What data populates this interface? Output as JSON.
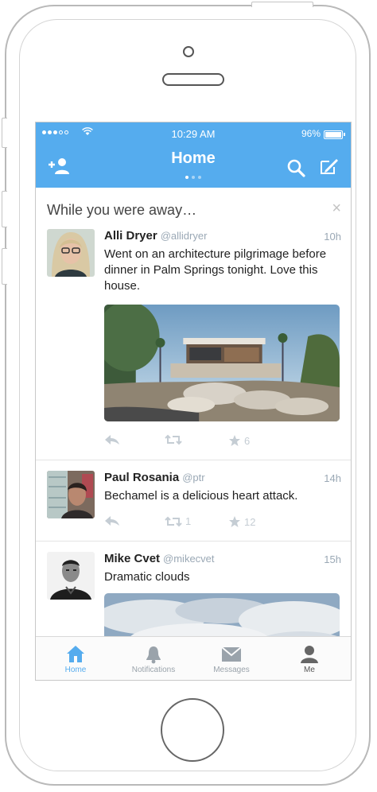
{
  "status_bar": {
    "time": "10:29 AM",
    "battery": "96%"
  },
  "nav": {
    "title": "Home"
  },
  "banner": {
    "title": "While you were away…",
    "close": "×"
  },
  "tweets": [
    {
      "name": "Alli Dryer",
      "handle": "@allidryer",
      "time": "10h",
      "text": "Went on an architecture pilgrimage before dinner in Palm Springs tonight. Love this house.",
      "retweets": "",
      "favorites": "6"
    },
    {
      "name": "Paul Rosania",
      "handle": "@ptr",
      "time": "14h",
      "text": "Bechamel is a delicious heart attack.",
      "retweets": "1",
      "favorites": "12"
    },
    {
      "name": "Mike Cvet",
      "handle": "@mikecvet",
      "time": "15h",
      "text": "Dramatic clouds"
    }
  ],
  "tabs": [
    {
      "label": "Home",
      "icon": "home-icon"
    },
    {
      "label": "Notifications",
      "icon": "bell-icon"
    },
    {
      "label": "Messages",
      "icon": "envelope-icon"
    },
    {
      "label": "Me",
      "icon": "person-icon"
    }
  ],
  "colors": {
    "brand": "#55acee",
    "text": "#222222",
    "muted": "#9aa8b5"
  }
}
